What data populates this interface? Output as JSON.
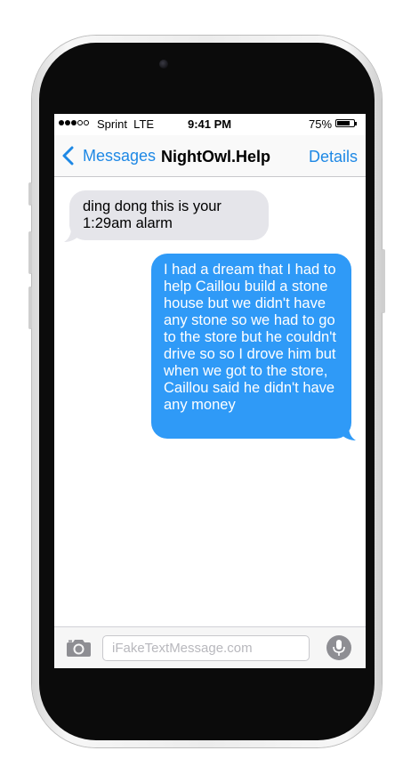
{
  "status_bar": {
    "carrier": "Sprint  LTE",
    "time": "9:41 PM",
    "battery_percent": "75%",
    "battery_level": 0.75,
    "signal_bars_filled": 3,
    "signal_bars_total": 5
  },
  "nav": {
    "back_label": "Messages",
    "title": "NightOwl.Help",
    "details_label": "Details"
  },
  "messages": [
    {
      "direction": "received",
      "text": "ding dong this is your 1:29am alarm"
    },
    {
      "direction": "sent",
      "text": "I had a dream that I had to help Caillou build a stone house but we didn't have any stone so we had to go to the store but he couldn't drive so so I drove him but when we got to the store, Caillou said he didn't have any money"
    }
  ],
  "composer": {
    "placeholder": "iFakeTextMessage.com",
    "camera_icon": "camera-icon",
    "mic_icon": "microphone-icon"
  },
  "colors": {
    "accent": "#1e88e5",
    "sent_bubble": "#2f9af7",
    "received_bubble": "#e5e5ea"
  }
}
